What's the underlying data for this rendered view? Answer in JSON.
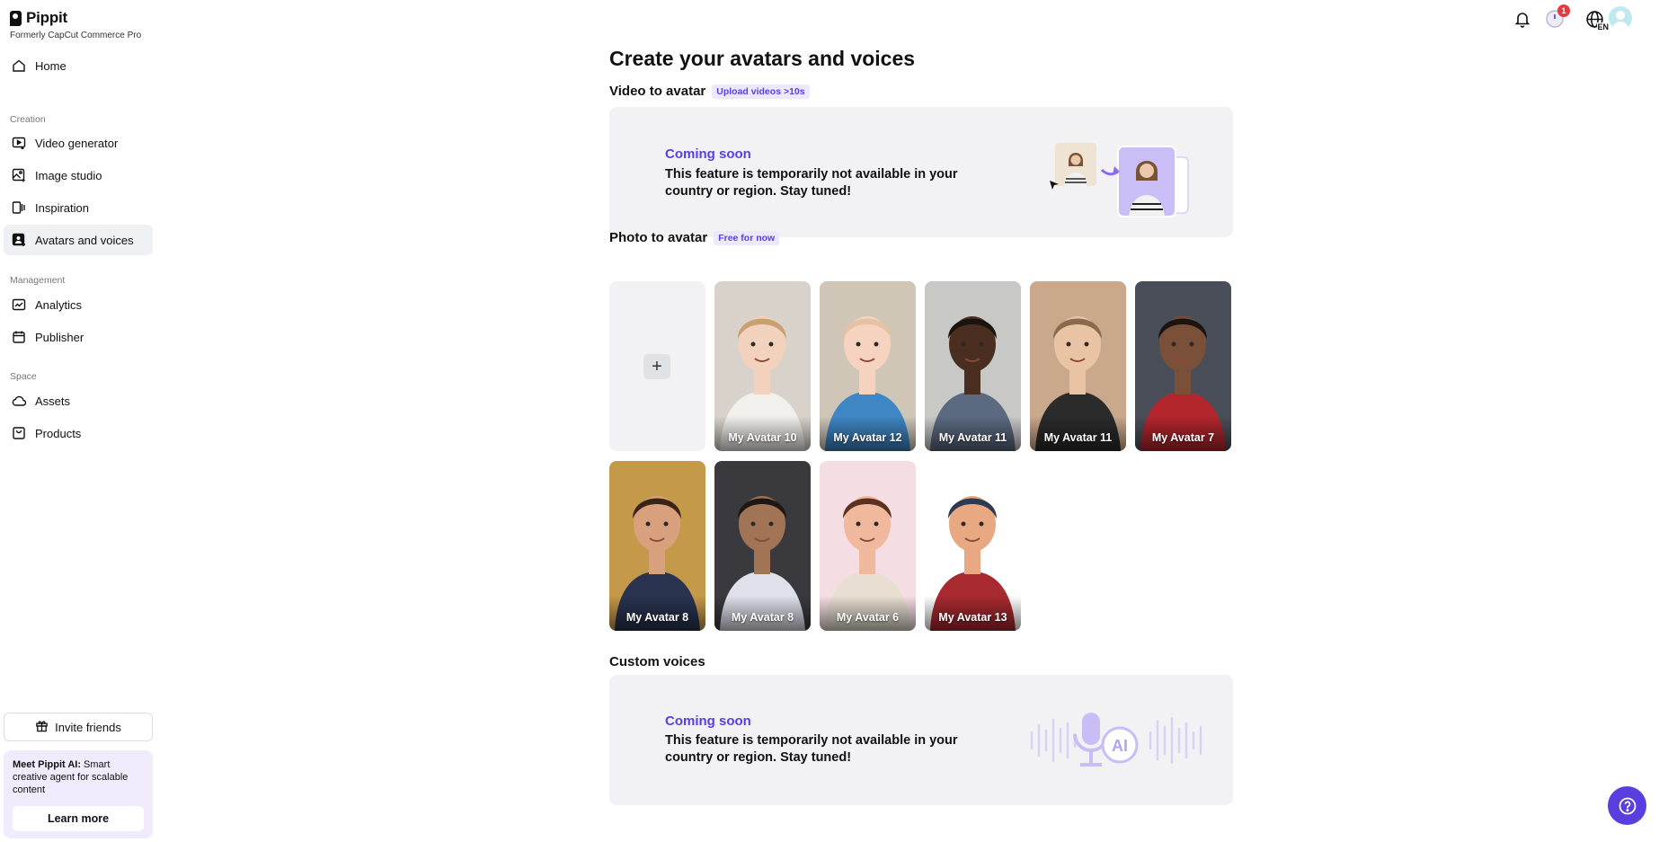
{
  "brand": {
    "name": "Pippit",
    "subtitle": "Formerly CapCut Commerce Pro"
  },
  "sidebar": {
    "home": "Home",
    "sections": {
      "creation": "Creation",
      "management": "Management",
      "space": "Space"
    },
    "items": {
      "video_generator": "Video generator",
      "image_studio": "Image studio",
      "inspiration": "Inspiration",
      "avatars_voices": "Avatars and voices",
      "analytics": "Analytics",
      "publisher": "Publisher",
      "assets": "Assets",
      "products": "Products"
    },
    "active": "avatars_voices",
    "invite": "Invite friends",
    "promo": {
      "bold": "Meet Pippit AI:",
      "text": " Smart creative agent for scalable content",
      "button": "Learn more"
    }
  },
  "topbar": {
    "notification_badge": "1",
    "language": "EN"
  },
  "main": {
    "title": "Create your avatars and voices",
    "video_to_avatar": {
      "title": "Video to avatar",
      "tag": "Upload videos >10s",
      "coming": "Coming soon",
      "desc": "This feature is temporarily not available in your country or region. Stay tuned!"
    },
    "photo_to_avatar": {
      "title": "Photo to avatar",
      "tag": "Free for now",
      "add_label": "+",
      "avatars": [
        {
          "label": "My Avatar 10",
          "bg": "#d8d2cb",
          "skin": "#f2d2bd",
          "hair": "#c9a070",
          "shirt": "#f2f0ec"
        },
        {
          "label": "My Avatar 12",
          "bg": "#cfc6b8",
          "skin": "#f5d3bf",
          "hair": "#e4c2a2",
          "shirt": "#3f86c4"
        },
        {
          "label": "My Avatar 11",
          "bg": "#c8c8c6",
          "skin": "#4a2e20",
          "hair": "#1a1310",
          "shirt": "#5b6a80"
        },
        {
          "label": "My Avatar 11",
          "bg": "#caa88c",
          "skin": "#e8c4a4",
          "hair": "#8a6a4c",
          "shirt": "#2b2b2b"
        },
        {
          "label": "My Avatar 7",
          "bg": "#4a4e58",
          "skin": "#7a5038",
          "hair": "#1b1410",
          "shirt": "#b3262d"
        },
        {
          "label": "My Avatar 8",
          "bg": "#c49a4a",
          "skin": "#d8a07c",
          "hair": "#3a2418",
          "shirt": "#2a3450"
        },
        {
          "label": "My Avatar 8",
          "bg": "#3a3a3e",
          "skin": "#a27456",
          "hair": "#1f1712",
          "shirt": "#dfe0ea"
        },
        {
          "label": "My Avatar 6",
          "bg": "#f5dde4",
          "skin": "#f0b89c",
          "hair": "#5c3120",
          "shirt": "#e8dfd2"
        },
        {
          "label": "My Avatar 13",
          "bg": "#ffffff",
          "skin": "#e8a882",
          "hair": "#2c3a52",
          "shirt": "#a82a30"
        }
      ]
    },
    "custom_voices": {
      "title": "Custom voices",
      "coming": "Coming soon",
      "desc": "This feature is temporarily not available in your country or region. Stay tuned!",
      "ai_label": "AI"
    }
  },
  "colors": {
    "accent": "#5b3ee0",
    "tag_bg": "#eee8fe",
    "card_bg": "#f2f2f4",
    "badge": "#e8393d"
  }
}
